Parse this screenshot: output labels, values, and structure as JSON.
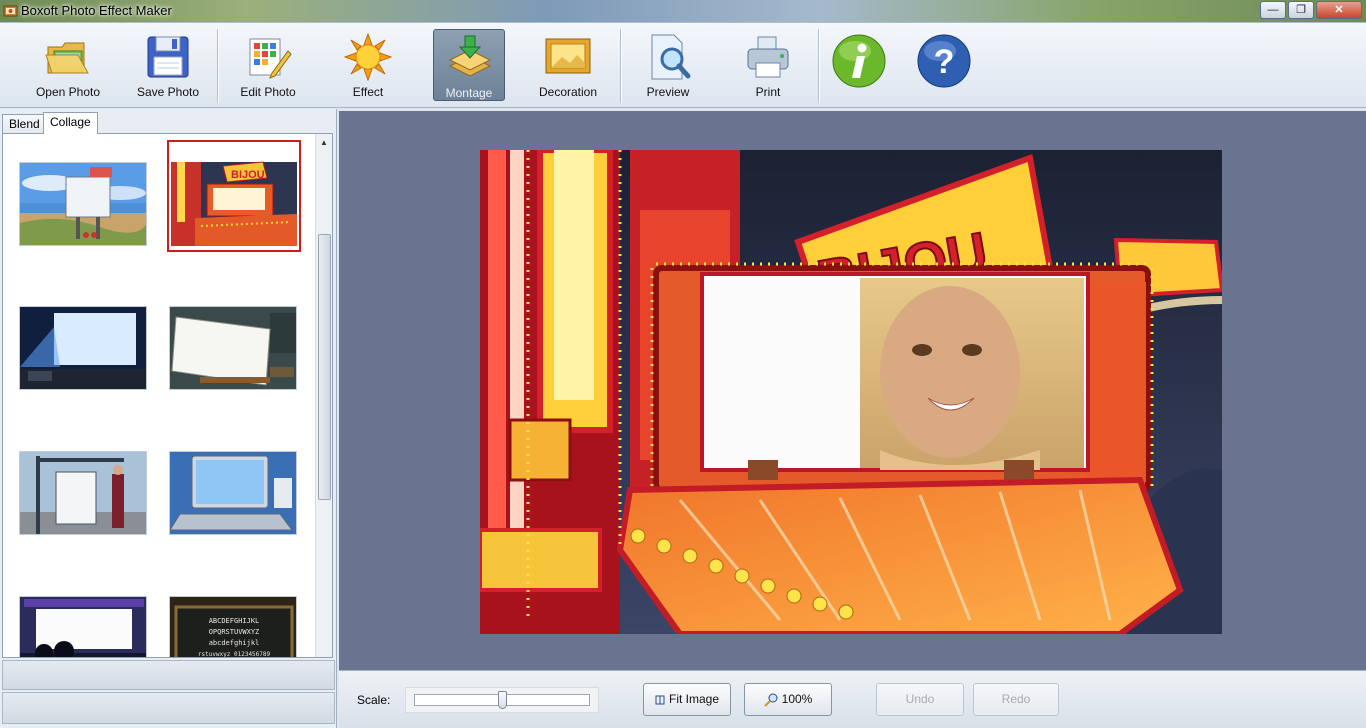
{
  "window": {
    "title": "Boxoft Photo Effect Maker",
    "controls": {
      "minimize": "—",
      "maximize": "❐",
      "close": "✕"
    }
  },
  "toolbar": {
    "items": [
      {
        "label": "Open Photo",
        "icon": "open-folder-icon"
      },
      {
        "label": "Save Photo",
        "icon": "floppy-disk-icon"
      },
      {
        "label": "Edit Photo",
        "icon": "edit-grid-pencil-icon"
      },
      {
        "label": "Effect",
        "icon": "sun-icon"
      },
      {
        "label": "Montage",
        "icon": "montage-layers-icon",
        "active": true
      },
      {
        "label": "Decoration",
        "icon": "frame-icon"
      },
      {
        "label": "Preview",
        "icon": "magnifier-page-icon"
      },
      {
        "label": "Print",
        "icon": "printer-icon"
      },
      {
        "label": "",
        "icon": "info-icon"
      },
      {
        "label": "",
        "icon": "help-icon"
      }
    ]
  },
  "left_panel": {
    "tabs": [
      "Blend",
      "Collage"
    ],
    "active_tab": "Collage",
    "thumbnails": [
      {
        "name": "beach-billboard",
        "selected": false
      },
      {
        "name": "theater-marquee",
        "selected": true
      },
      {
        "name": "projection-screen",
        "selected": false
      },
      {
        "name": "easel-canvas",
        "selected": false
      },
      {
        "name": "bus-stop-poster",
        "selected": false
      },
      {
        "name": "laptop-screen",
        "selected": false
      },
      {
        "name": "cinema-screen",
        "selected": false
      },
      {
        "name": "chalkboard-alphabet",
        "selected": false
      }
    ],
    "chalkboard_text": [
      "ABCDEFGHIJKL",
      "OPQRSTUVWXYZ",
      "abcdefghijkl",
      "rstuvwxyz 0123456789"
    ]
  },
  "canvas": {
    "sign_text": "BIJOU",
    "accent_red": "#d4202a",
    "accent_yellow": "#ffd53a",
    "background": "#6a7490"
  },
  "bottom_bar": {
    "scale_label": "Scale:",
    "scale_position": 0.5,
    "fit_image": "Fit Image",
    "zoom_100": "100%",
    "undo": "Undo",
    "redo": "Redo"
  }
}
